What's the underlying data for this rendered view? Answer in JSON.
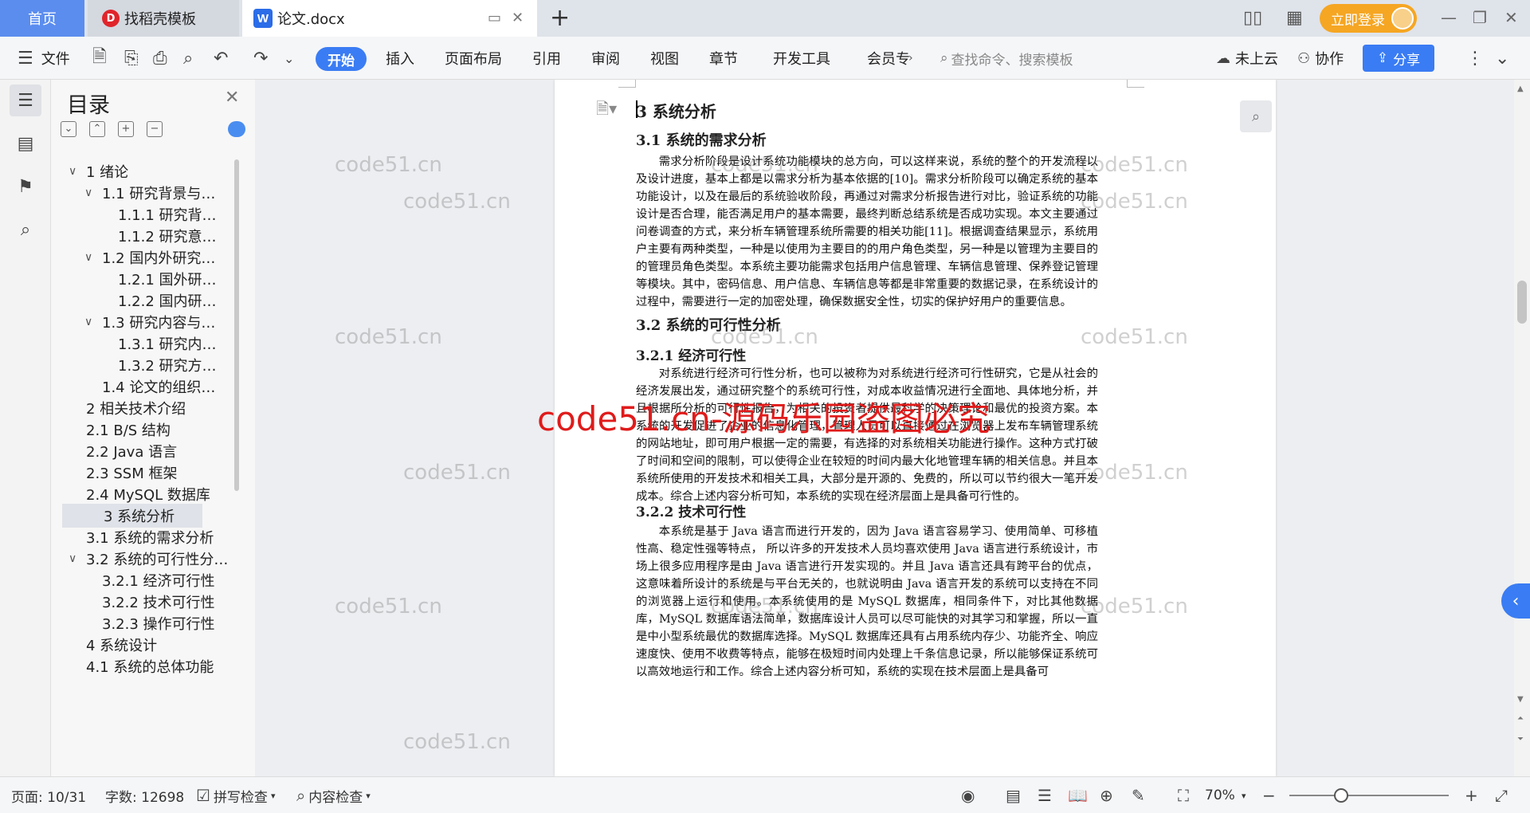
{
  "tabs": {
    "home": "首页",
    "templates": "找稻壳模板",
    "doc": "论文.docx",
    "tpl_logo": "D",
    "doc_logo": "W",
    "add": "+"
  },
  "titlebar": {
    "login": "立即登录"
  },
  "ribbon": {
    "menu": "文件",
    "tabs": [
      "开始",
      "插入",
      "页面布局",
      "引用",
      "审阅",
      "视图",
      "章节",
      "开发工具",
      "会员专"
    ],
    "search_placeholder": "查找命令、搜索模板",
    "cloud": "未上云",
    "collab": "协作",
    "share": "分享"
  },
  "outline": {
    "title": "目录",
    "items": [
      {
        "label": "1 绪论",
        "level": 0,
        "chev": "∨"
      },
      {
        "label": "1.1 研究背景与…",
        "level": 1,
        "chev": "∨"
      },
      {
        "label": "1.1.1 研究背…",
        "level": 2,
        "chev": ""
      },
      {
        "label": "1.1.2 研究意…",
        "level": 2,
        "chev": ""
      },
      {
        "label": "1.2 国内外研究…",
        "level": 1,
        "chev": "∨"
      },
      {
        "label": "1.2.1 国外研…",
        "level": 2,
        "chev": ""
      },
      {
        "label": "1.2.2 国内研…",
        "level": 2,
        "chev": ""
      },
      {
        "label": "1.3 研究内容与…",
        "level": 1,
        "chev": "∨"
      },
      {
        "label": "1.3.1 研究内…",
        "level": 2,
        "chev": ""
      },
      {
        "label": "1.3.2 研究方…",
        "level": 2,
        "chev": ""
      },
      {
        "label": "1.4 论文的组织…",
        "level": 1,
        "chev": ""
      },
      {
        "label": "2 相关技术介绍",
        "level": 0,
        "chev": ""
      },
      {
        "label": "2.1 B/S 结构",
        "level": 0,
        "chev": ""
      },
      {
        "label": "2.2 Java 语言",
        "level": 0,
        "chev": ""
      },
      {
        "label": "2.3 SSM 框架",
        "level": 0,
        "chev": ""
      },
      {
        "label": "2.4 MySQL 数据库",
        "level": 0,
        "chev": ""
      },
      {
        "label": "3 系统分析",
        "level": 0,
        "chev": "",
        "selected": true
      },
      {
        "label": "3.1 系统的需求分析",
        "level": 0,
        "chev": ""
      },
      {
        "label": "3.2 系统的可行性分…",
        "level": 0,
        "chev": "∨"
      },
      {
        "label": "3.2.1 经济可行性",
        "level": 1,
        "chev": ""
      },
      {
        "label": "3.2.2 技术可行性",
        "level": 1,
        "chev": ""
      },
      {
        "label": "3.2.3 操作可行性",
        "level": 1,
        "chev": ""
      },
      {
        "label": "4 系统设计",
        "level": 0,
        "chev": ""
      },
      {
        "label": "4.1 系统的总体功能",
        "level": 0,
        "chev": ""
      }
    ]
  },
  "document": {
    "h1": "3 系统分析",
    "h2_1": "3.1 系统的需求分析",
    "p1": "需求分析阶段是设计系统功能模块的总方向，可以这样来说，系统的整个的开发流程以及设计进度，基本上都是以需求分析为基本依据的[10]。需求分析阶段可以确定系统的基本功能设计，以及在最后的系统验收阶段，再通过对需求分析报告进行对比，验证系统的功能设计是否合理，能否满足用户的基本需要，最终判断总结系统是否成功实现。本文主要通过问卷调查的方式，来分析车辆管理系统所需要的相关功能[11]。根据调查结果显示，系统用户主要有两种类型，一种是以使用为主要目的的用户角色类型，另一种是以管理为主要目的的管理员角色类型。本系统主要功能需求包括用户信息管理、车辆信息管理、保养登记管理等模块。其中，密码信息、用户信息、车辆信息等都是非常重要的数据记录，在系统设计的过程中，需要进行一定的加密处理，确保数据安全性，切实的保护好用户的重要信息。",
    "h2_2": "3.2 系统的可行性分析",
    "h3_1": "3.2.1 经济可行性",
    "p2": "对系统进行经济可行性分析，也可以被称为对系统进行经济可行性研究，它是从社会的经济发展出发，通过研究整个的系统可行性，对成本收益情况进行全面地、具体地分析，并且根据所分析的可行性报告，为相关的投资者提供最科学的决策理论和最优的投资方案。本系统的开发促进了企业的信息化管理，管理人员可以直接通过在浏览器上发布车辆管理系统的网站地址，即可用户根据一定的需要，有选择的对系统相关功能进行操作。这种方式打破了时间和空间的限制，可以使得企业在较短的时间内最大化地管理车辆的相关信息。并且本系统所使用的开发技术和相关工具，大部分是开源的、免费的，所以可以节约很大一笔开发成本。综合上述内容分析可知，本系统的实现在经济层面上是具备可行性的。",
    "h3_2": "3.2.2 技术可行性",
    "p3": "本系统是基于 Java 语言而进行开发的，因为 Java 语言容易学习、使用简单、可移植性高、稳定性强等特点， 所以许多的开发技术人员均喜欢使用 Java 语言进行系统设计，市场上很多应用程序是由 Java 语言进行开发实现的。并且 Java 语言还具有跨平台的优点，这意味着所设计的系统是与平台无关的，也就说明由 Java 语言开发的系统可以支持在不同的浏览器上运行和使用。本系统使用的是 MySQL 数据库，相同条件下，对比其他数据库，MySQL 数据库语法简单，数据库设计人员可以尽可能快的对其学习和掌握，所以一直是中小型系统最优的数据库选择。MySQL 数据库还具有占用系统内存少、功能齐全、响应速度快、使用不收费等特点，能够在极短时间内处理上千条信息记录，所以能够保证系统可以高效地运行和工作。综合上述内容分析可知，系统的实现在技术层面上是具备可"
  },
  "watermarks": {
    "small": "code51.cn",
    "big": "code51.cn-源码乐园盗图必究"
  },
  "statusbar": {
    "page": "页面: 10/31",
    "words": "字数: 12698",
    "spell": "拼写检查",
    "content": "内容检查",
    "zoom": "70%"
  }
}
